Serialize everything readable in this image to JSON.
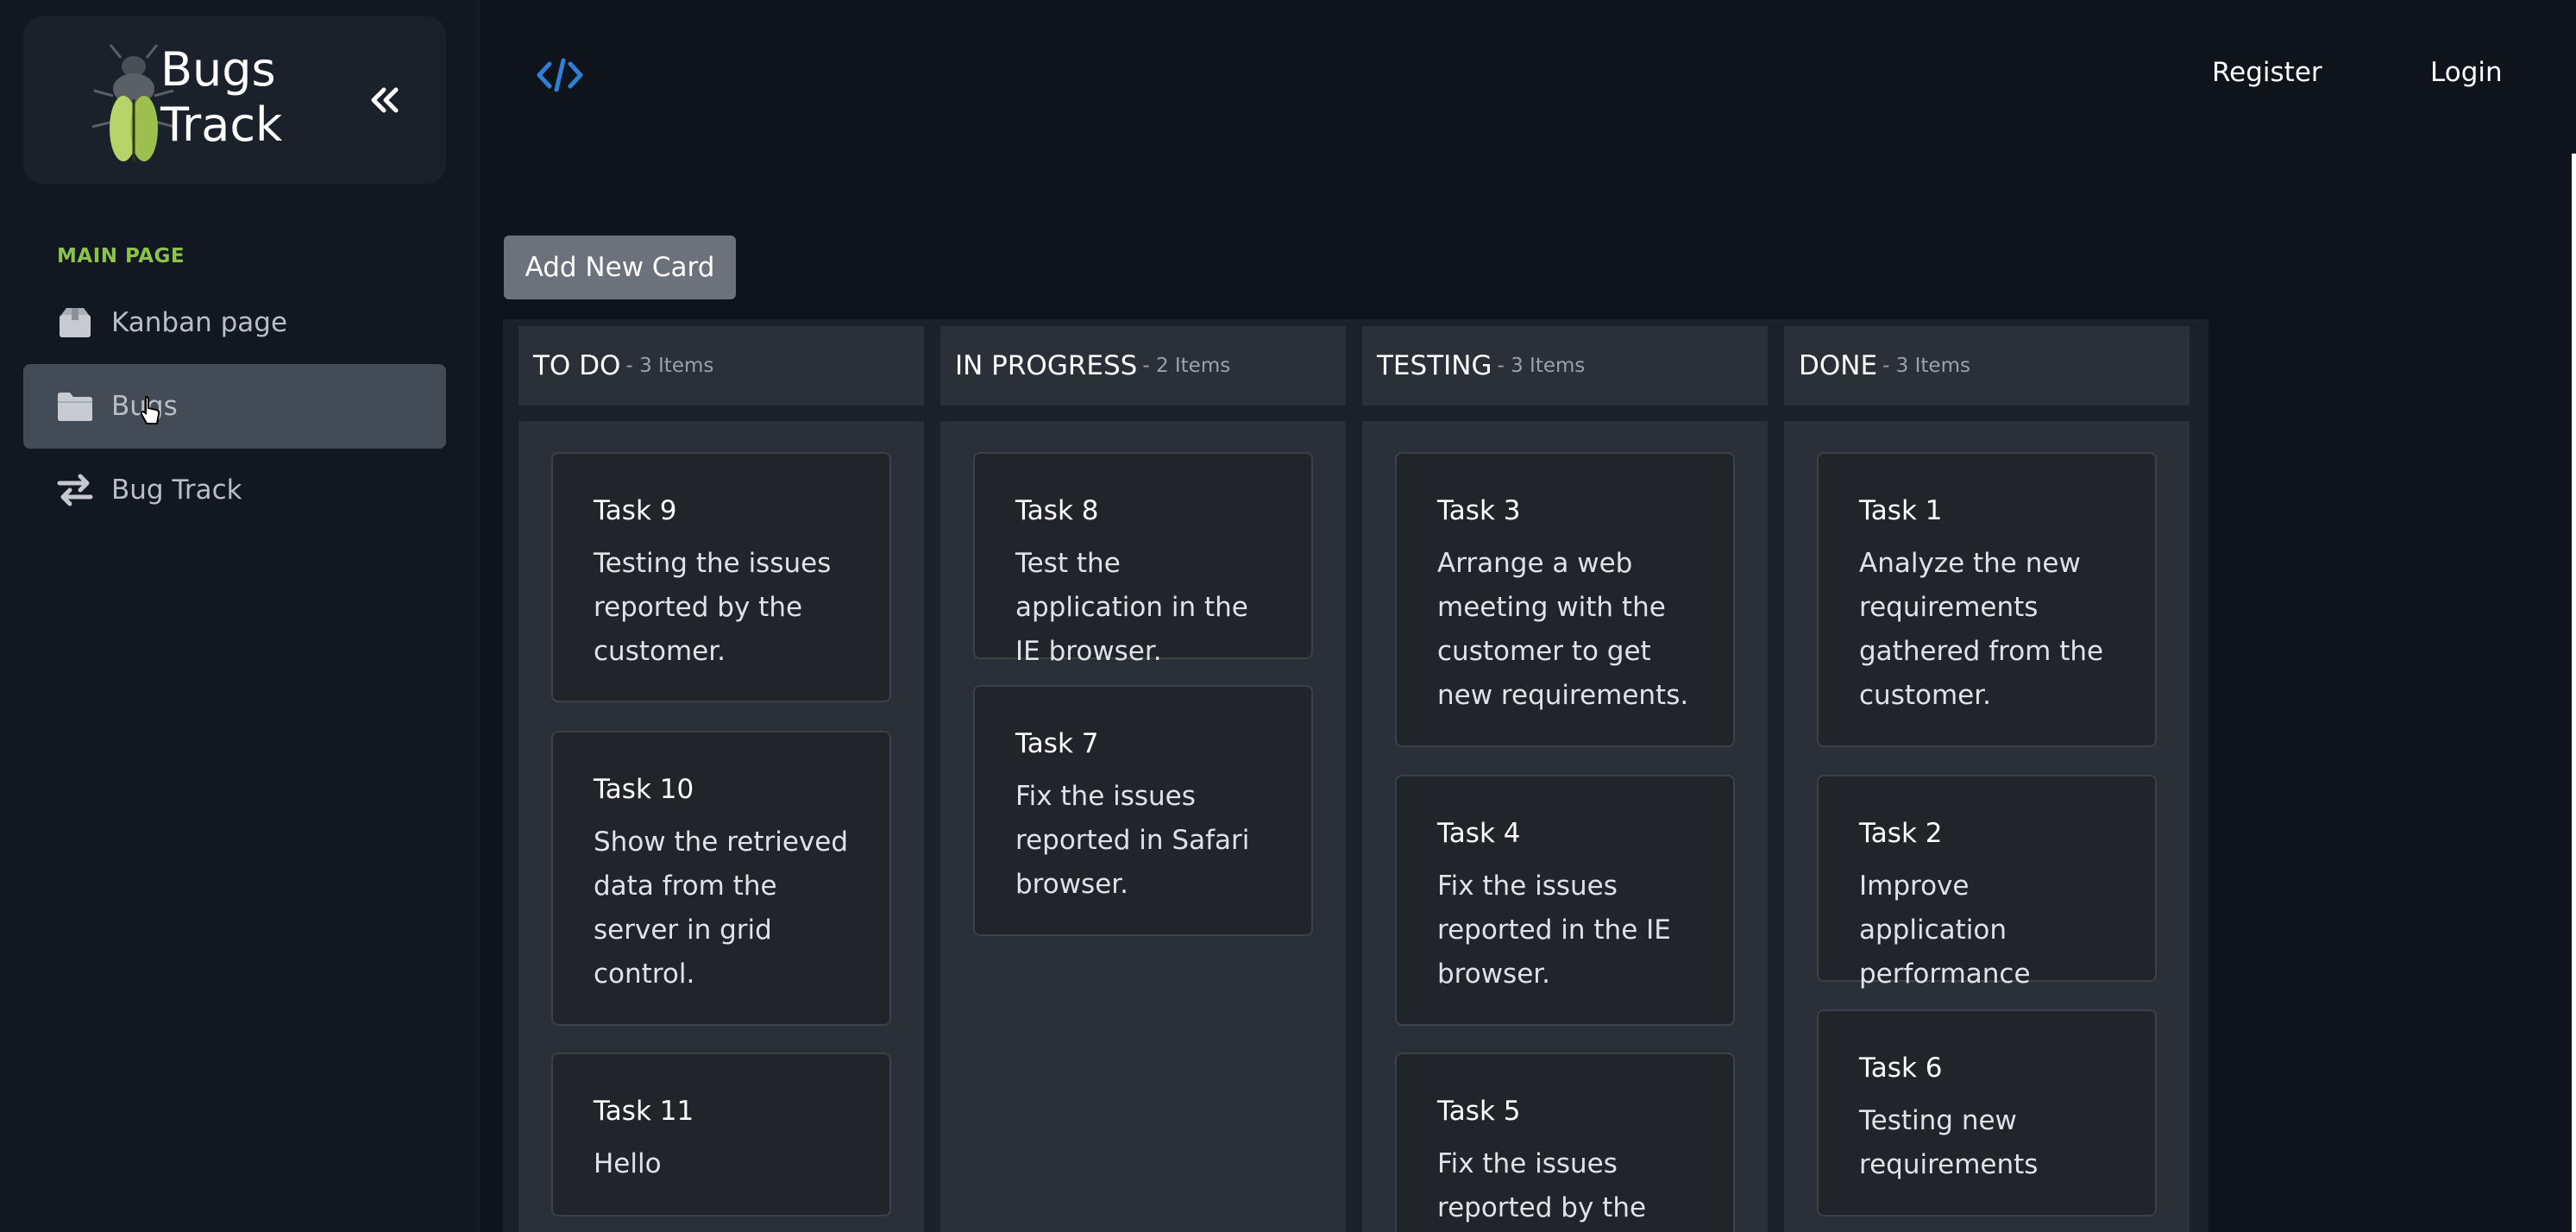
{
  "brand": {
    "line1": "Bugs",
    "line2": "Track"
  },
  "sidebar": {
    "section_label": "MAIN PAGE",
    "items": [
      {
        "label": "Kanban page",
        "icon": "box-icon"
      },
      {
        "label": "Bugs",
        "icon": "folder-icon",
        "active": true
      },
      {
        "label": "Bug Track",
        "icon": "swap-arrows-icon"
      }
    ]
  },
  "topbar": {
    "register_label": "Register",
    "login_label": "Login"
  },
  "toolbar": {
    "add_card_label": "Add New Card"
  },
  "colors": {
    "accent_green": "#8bc34a",
    "code_icon_blue": "#2f7fd6"
  },
  "columns": [
    {
      "title": "TO DO",
      "count": "- 3 Items",
      "cards": [
        {
          "title": "Task 9",
          "desc": "Testing the issues reported by the customer."
        },
        {
          "title": "Task 10",
          "desc": "Show the retrieved data from the server in grid control."
        },
        {
          "title": "Task 11",
          "desc": "Hello"
        }
      ]
    },
    {
      "title": "IN PROGRESS",
      "count": "- 2 Items",
      "cards": [
        {
          "title": "Task 8",
          "desc": "Test the application in the IE browser."
        },
        {
          "title": "Task 7",
          "desc": "Fix the issues reported in Safari browser."
        }
      ]
    },
    {
      "title": "TESTING",
      "count": "- 3 Items",
      "cards": [
        {
          "title": "Task 3",
          "desc": "Arrange a web meeting with the customer to get new requirements."
        },
        {
          "title": "Task 4",
          "desc": "Fix the issues reported in the IE browser."
        },
        {
          "title": "Task 5",
          "desc": "Fix the issues reported by the"
        }
      ]
    },
    {
      "title": "DONE",
      "count": "- 3 Items",
      "cards": [
        {
          "title": "Task 1",
          "desc": "Analyze the new requirements gathered from the customer."
        },
        {
          "title": "Task 2",
          "desc": "Improve application performance"
        },
        {
          "title": "Task 6",
          "desc": "Testing new requirements"
        }
      ]
    }
  ]
}
